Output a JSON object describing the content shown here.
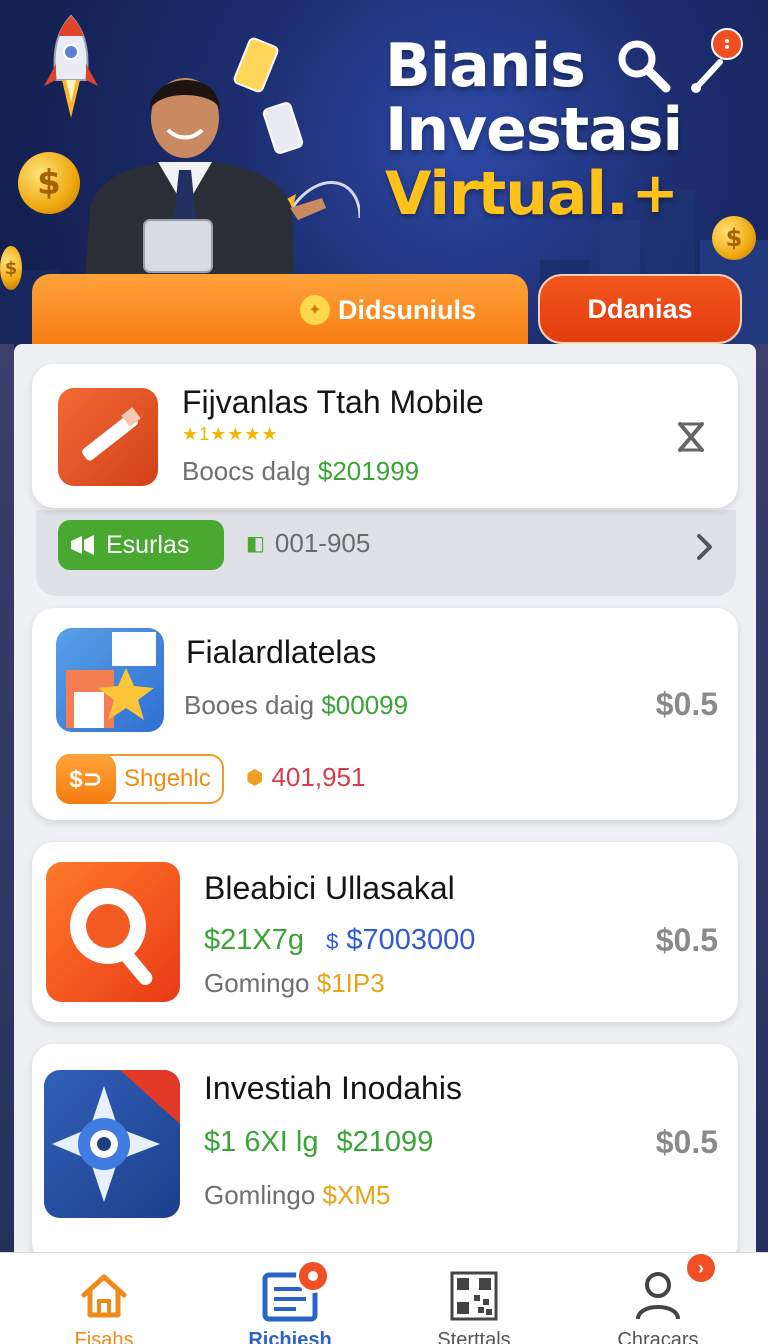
{
  "hero": {
    "title_line1": "Bianis",
    "title_line2": "Investasi",
    "title_line3": "Virtual.",
    "title_plus": "+",
    "btn_left": "Didsuniuls",
    "btn_right": "Ddanias"
  },
  "cards": [
    {
      "title": "Fijvanlas Ttah Mobile",
      "rating": "★1★★★★",
      "meta_label": "Boocs dalg",
      "meta_value": "$201999",
      "tag_label": "Esurlas",
      "tag_code": "001-905"
    },
    {
      "title": "Fialardlatelas",
      "meta_label": "Booes daig",
      "meta_value": "$00099",
      "price": "$0.5",
      "tag_icon": "$⊃",
      "tag_label": "Shgehlc",
      "tag_code": "401,951"
    },
    {
      "title": "Bleabici Ullasakal",
      "line1_green": "$21X7g",
      "line1_blue": "$7003000",
      "line2_label": "Gomingo",
      "line2_value": "$1IP3",
      "price": "$0.5"
    },
    {
      "title": "Investiah Inodahis",
      "line1_green": "$1 6XI lg",
      "line1_green2": "$21099",
      "line2_label": "Gomlingo",
      "line2_value": "$XM5",
      "price": "$0.5"
    }
  ],
  "nav": {
    "items": [
      {
        "label": "Fisahs"
      },
      {
        "label": "Richiesh"
      },
      {
        "label": "Sterttals"
      },
      {
        "label": "Chracars"
      }
    ]
  },
  "colors": {
    "accent_orange": "#f57c12",
    "accent_red": "#e23c10",
    "green": "#3aa437",
    "blue": "#2f5bd8",
    "gold": "#ffc21a"
  }
}
